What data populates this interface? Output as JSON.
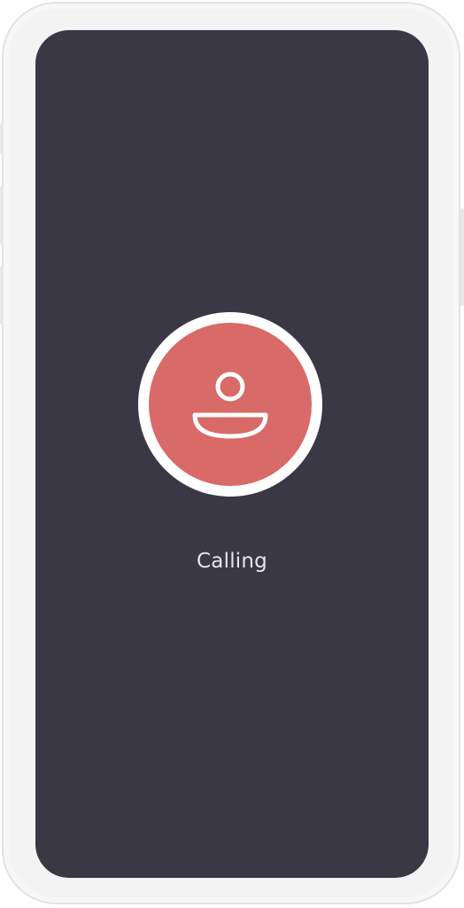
{
  "call": {
    "status": "Calling",
    "avatar_icon": "person-icon"
  },
  "colors": {
    "screen_background": "#3a3845",
    "avatar_background": "#d86a68",
    "avatar_ring": "#ffffff",
    "status_text": "#e6e6ea"
  }
}
